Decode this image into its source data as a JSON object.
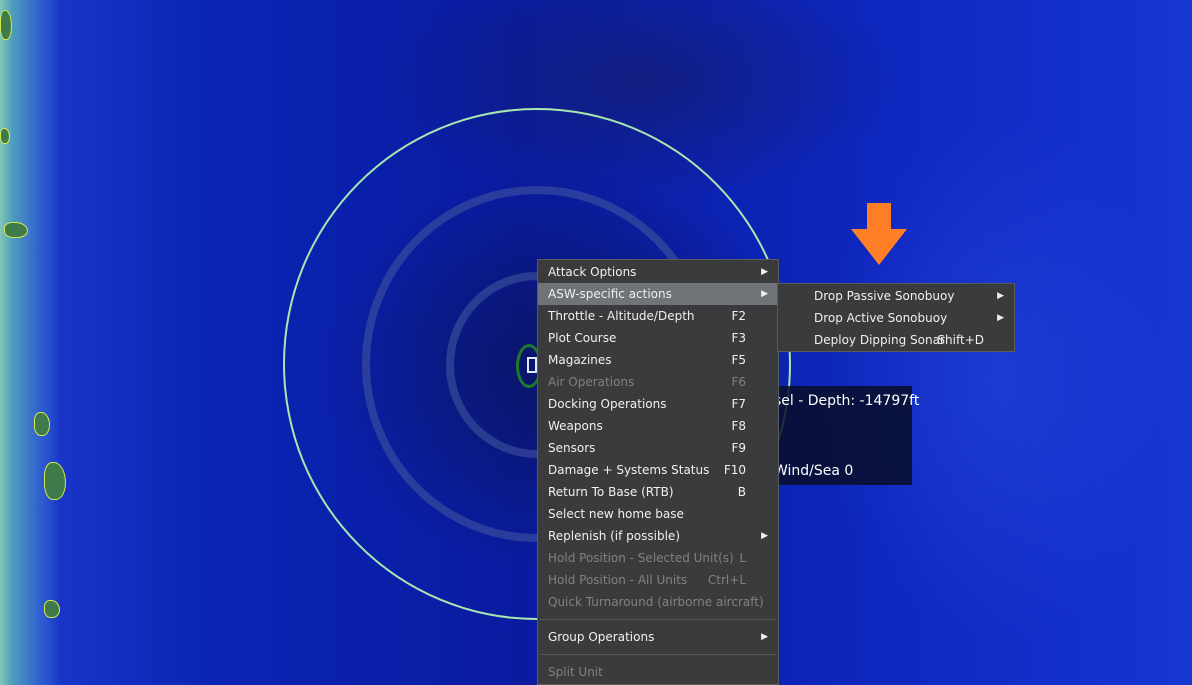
{
  "map": {
    "info_depth": "sel - Depth: -14797ft",
    "info_wind": "Wind/Sea 0",
    "colors": {
      "ring": "#a8e8b0",
      "arrow": "#ff7f27",
      "menu_bg": "#3a3b3d",
      "highlight": "#707377"
    }
  },
  "context_menu": {
    "items": [
      {
        "label": "Attack Options",
        "shortcut": "",
        "submenu": true,
        "disabled": false
      },
      {
        "label": "ASW-specific actions",
        "shortcut": "",
        "submenu": true,
        "disabled": false,
        "highlighted": true
      },
      {
        "label": "Throttle - Altitude/Depth",
        "shortcut": "F2",
        "submenu": false,
        "disabled": false
      },
      {
        "label": "Plot Course",
        "shortcut": "F3",
        "submenu": false,
        "disabled": false
      },
      {
        "label": "Magazines",
        "shortcut": "F5",
        "submenu": false,
        "disabled": false
      },
      {
        "label": "Air Operations",
        "shortcut": "F6",
        "submenu": false,
        "disabled": true
      },
      {
        "label": "Docking Operations",
        "shortcut": "F7",
        "submenu": false,
        "disabled": false
      },
      {
        "label": "Weapons",
        "shortcut": "F8",
        "submenu": false,
        "disabled": false
      },
      {
        "label": "Sensors",
        "shortcut": "F9",
        "submenu": false,
        "disabled": false
      },
      {
        "label": "Damage + Systems Status",
        "shortcut": "F10",
        "submenu": false,
        "disabled": false
      },
      {
        "label": "Return To Base (RTB)",
        "shortcut": "B",
        "submenu": false,
        "disabled": false
      },
      {
        "label": "Select new home base",
        "shortcut": "",
        "submenu": false,
        "disabled": false
      },
      {
        "label": "Replenish (if possible)",
        "shortcut": "",
        "submenu": true,
        "disabled": false
      },
      {
        "label": "Hold Position - Selected Unit(s)",
        "shortcut": "L",
        "submenu": false,
        "disabled": true
      },
      {
        "label": "Hold Position - All Units",
        "shortcut": "Ctrl+L",
        "submenu": false,
        "disabled": true
      },
      {
        "label": "Quick Turnaround (airborne aircraft)",
        "shortcut": "",
        "submenu": false,
        "disabled": true
      },
      {
        "label": "Group Operations",
        "shortcut": "",
        "submenu": true,
        "disabled": false
      },
      {
        "label": "Split Unit",
        "shortcut": "",
        "submenu": false,
        "disabled": true
      }
    ]
  },
  "asw_submenu": {
    "items": [
      {
        "label": "Drop Passive Sonobuoy",
        "shortcut": "",
        "submenu": true
      },
      {
        "label": "Drop Active Sonobuoy",
        "shortcut": "",
        "submenu": true
      },
      {
        "label": "Deploy Dipping Sonar",
        "shortcut": "Shift+D",
        "submenu": false
      }
    ]
  }
}
